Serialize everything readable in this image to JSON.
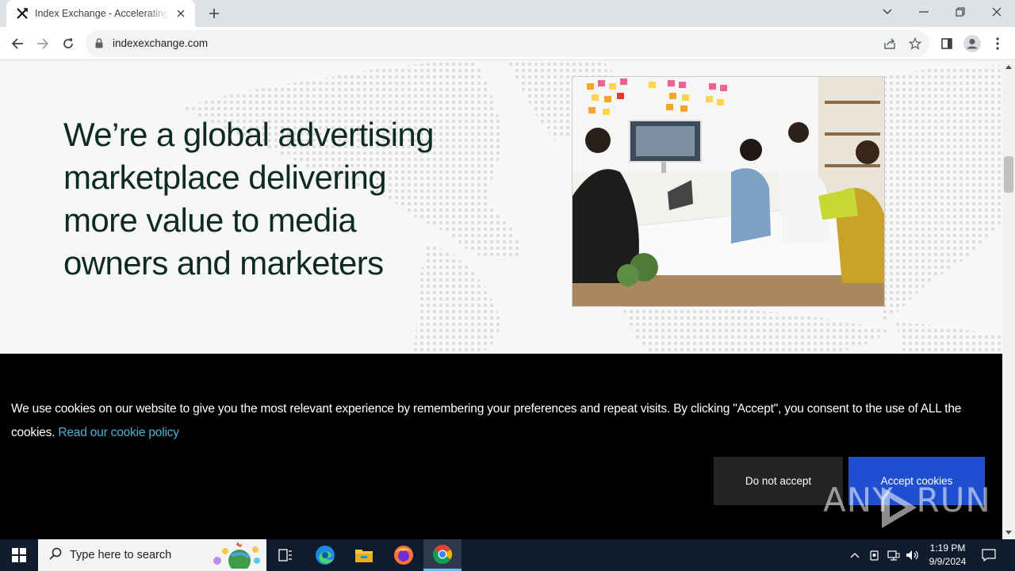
{
  "browser": {
    "tab_title": "Index Exchange - Accelerating th",
    "url": "indexexchange.com"
  },
  "page": {
    "hero_heading": "We’re a global advertising marketplace delivering more value to media owners and marketers"
  },
  "cookie_banner": {
    "message": "We use cookies on our website to give you the most relevant experience by remembering your preferences and repeat visits. By clicking \"Accept\", you consent to the use of ALL the cookies. ",
    "link_text": "Read our cookie policy",
    "decline_label": "Do not accept",
    "accept_label": "Accept cookies",
    "watermark": "ANY  RUN"
  },
  "taskbar": {
    "search_placeholder": "Type here to search",
    "time": "1:19 PM",
    "date": "9/9/2024"
  },
  "colors": {
    "heading": "#0d2b21",
    "link": "#4cb2d4",
    "accept_bg": "#1f4fd0",
    "decline_bg": "#242424",
    "taskbar_bg": "#101c2c"
  },
  "icons": [
    "index-exchange-favicon",
    "close-icon",
    "plus-icon",
    "chevron-down-icon",
    "minimize-icon",
    "restore-icon",
    "window-close-icon",
    "back-icon",
    "forward-icon",
    "reload-icon",
    "lock-icon",
    "share-icon",
    "star-icon",
    "side-panel-icon",
    "profile-icon",
    "kebab-menu-icon",
    "windows-icon",
    "search-icon",
    "task-view-icon",
    "edge-icon",
    "file-explorer-icon",
    "firefox-icon",
    "chrome-icon",
    "chevron-up-icon",
    "network-icon",
    "volume-icon",
    "notification-icon"
  ]
}
